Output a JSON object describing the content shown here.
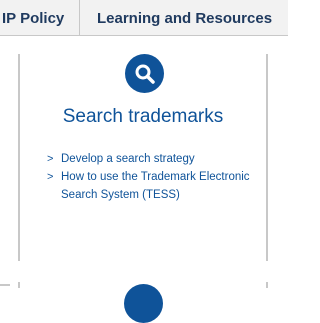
{
  "nav": {
    "items": [
      {
        "label": "IP Policy"
      },
      {
        "label": "Learning and Resources"
      }
    ]
  },
  "card": {
    "icon": "search-icon",
    "title": "Search trademarks",
    "links": [
      {
        "label": "Develop a search strategy"
      },
      {
        "label": "How to use the Trademark Electronic Search System (TESS)"
      }
    ]
  },
  "colors": {
    "brand_blue": "#0f5399",
    "nav_text": "#1f3a5f",
    "nav_bg": "#f2f2f2",
    "border": "#c8c8c8"
  }
}
